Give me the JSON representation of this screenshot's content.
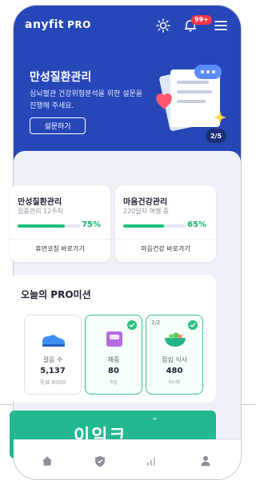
{
  "header": {
    "logo": "anyfit",
    "logo_pro": "PRO",
    "notification_count": "99+"
  },
  "hero": {
    "title": "만성질환관리",
    "description": "심뇌혈관 건강위험분석을 위한 설문을 진행해 주세요.",
    "button_label": "설문하기",
    "page_indicator": "2/5"
  },
  "cards": [
    {
      "title": "만성질환관리",
      "subtitle": "집중관리 12주차",
      "percent_label": "75%",
      "progress": 0.75,
      "link": "휴먼코칭 바로가기"
    },
    {
      "title": "마음건강관리",
      "subtitle": "220일차 여행 중",
      "percent_label": "65%",
      "progress": 0.65,
      "link": "마음건강 바로가기"
    }
  ],
  "missions": {
    "title": "오늘의 PRO미션",
    "items": [
      {
        "label": "걸음 수",
        "value": "5,137",
        "unit": "목표 8000",
        "done": false,
        "count": ""
      },
      {
        "label": "체중",
        "value": "80",
        "unit": "kg",
        "done": true,
        "count": ""
      },
      {
        "label": "점심 식사",
        "value": "480",
        "unit": "kcal",
        "done": true,
        "count": "2/2"
      }
    ]
  },
  "banner": {
    "text": "이익크"
  },
  "colors": {
    "brand_blue": "#2747b8",
    "accent_green": "#1fbf7a",
    "badge_red": "#ff3347",
    "banner_green": "#23b891"
  },
  "icons": {
    "header": [
      "sun-icon",
      "bell-icon",
      "menu-icon"
    ],
    "tabs": [
      "home-icon",
      "shield-check-icon",
      "bar-chart-icon",
      "user-icon"
    ]
  }
}
